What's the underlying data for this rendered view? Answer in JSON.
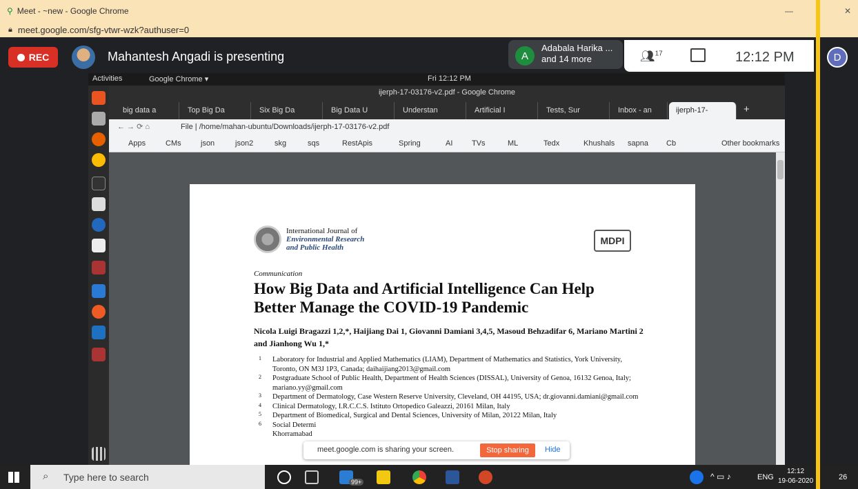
{
  "window": {
    "title": "Meet - ~new - Google Chrome",
    "url": "meet.google.com/sfg-vtwr-wzk?authuser=0",
    "minimize": "—",
    "close": "✕"
  },
  "meet": {
    "rec": "REC",
    "presenting": "Mahantesh Angadi is presenting",
    "participant_initial": "A",
    "participant_name": "Adabala Harika ...",
    "participant_more": "and 14 more",
    "people_count": "17",
    "time": "12:12 PM",
    "user_initial": "D"
  },
  "ubuntu": {
    "activities": "Activities",
    "app": "Google Chrome ▾",
    "clock": "Fri 12:12 PM"
  },
  "chrome": {
    "title": "ijerph-17-03176-v2.pdf - Google Chrome",
    "tabs": [
      "big data a",
      "Top Big Da",
      "Six Big Da",
      "Big Data U",
      "Understan",
      "Artificial I",
      "Tests, Sur",
      "Inbox - an",
      "ijerph-17-"
    ],
    "address": "File  |  /home/mahan-ubuntu/Downloads/ijerph-17-03176-v2.pdf",
    "bookmarks": [
      "Apps",
      "CMs",
      "json",
      "json2",
      "skg",
      "sqs",
      "RestApis",
      "Spring",
      "AI",
      "TVs",
      "ML",
      "Tedx",
      "Khushals",
      "sapna",
      "Cb"
    ],
    "other_bookmarks": "Other bookmarks"
  },
  "pdf": {
    "journal_line1": "International Journal of",
    "journal_line2": "Environmental Research",
    "journal_line3": "and Public Health",
    "publisher": "MDPI",
    "type": "Communication",
    "title": "How Big Data and Artificial Intelligence Can Help Better Manage the COVID-19 Pandemic",
    "authors": "Nicola Luigi Bragazzi 1,2,*, Haijiang Dai 1, Giovanni Damiani 3,4,5, Masoud Behzadifar 6, Mariano Martini 2 and Jianhong Wu 1,*",
    "affiliations": [
      {
        "n": "1",
        "t": "Laboratory for Industrial and Applied Mathematics (LIAM), Department of Mathematics and Statistics, York University, Toronto, ON M3J 1P3, Canada; daihaijiang2013@gmail.com"
      },
      {
        "n": "2",
        "t": "Postgraduate School of Public Health, Department of Health Sciences (DISSAL), University of Genoa, 16132 Genoa, Italy; mariano.yy@gmail.com"
      },
      {
        "n": "3",
        "t": "Department of Dermatology, Case Western Reserve University, Cleveland, OH 44195, USA; dr.giovanni.damiani@gmail.com"
      },
      {
        "n": "4",
        "t": "Clinical Dermatology, I.R.C.C.S. Istituto Ortopedico Galeazzi, 20161 Milan, Italy"
      },
      {
        "n": "5",
        "t": "Department of Biomedical, Surgical and Dental Sciences, University of Milan, 20122 Milan, Italy"
      },
      {
        "n": "6",
        "t": "Social Determi"
      },
      {
        "n": "",
        "t": "Khorramabad"
      }
    ]
  },
  "sharebar": {
    "msg": "meet.google.com is sharing your screen.",
    "stop": "Stop sharing",
    "hide": "Hide"
  },
  "taskbar": {
    "search": "Type here to search",
    "mail_badge": "99+",
    "lang": "ENG",
    "time": "12:12",
    "date": "19-06-2020",
    "notif": "26"
  }
}
